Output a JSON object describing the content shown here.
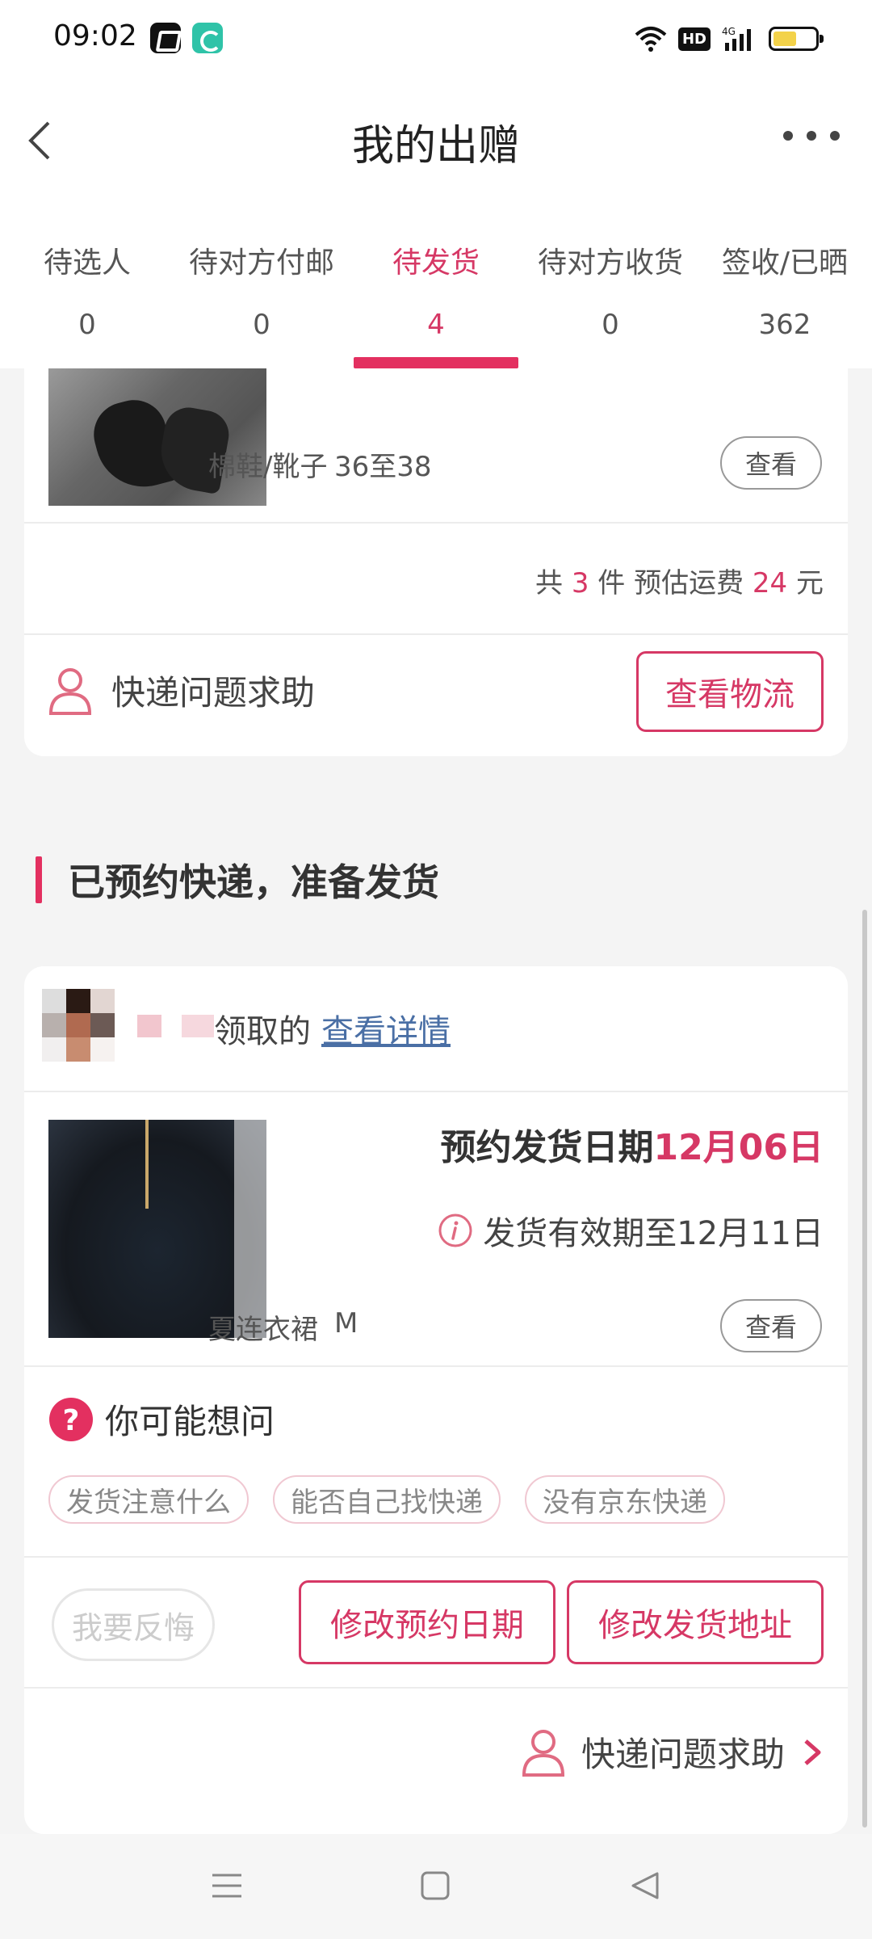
{
  "status": {
    "time": "09:02",
    "hd": "HD",
    "network": "4G"
  },
  "header": {
    "title": "我的出赠"
  },
  "tabs": [
    {
      "label": "待选人",
      "count": "0"
    },
    {
      "label": "待对方付邮",
      "count": "0"
    },
    {
      "label": "待发货",
      "count": "4",
      "active": true
    },
    {
      "label": "待对方收货",
      "count": "0"
    },
    {
      "label": "签收/已晒",
      "count": "362"
    }
  ],
  "card1": {
    "item_name": "棉鞋/靴子",
    "item_size": "36至38",
    "view_label": "查看",
    "summary_prefix": "共",
    "summary_count": "3",
    "summary_middle": "件 预估运费",
    "summary_fee": "24",
    "summary_suffix": "元",
    "help_label": "快递问题求助",
    "logistics_label": "查看物流"
  },
  "section": {
    "title": "已预约快递，准备发货"
  },
  "card2": {
    "receiver_suffix": "领取的",
    "detail_link": "查看详情",
    "ship_date_label": "预约发货日期",
    "ship_date_value": "12月06日",
    "valid_label": "发货有效期至12月11日",
    "item_name": "夏连衣裙",
    "item_size": "M",
    "view_label": "查看",
    "faq_title": "你可能想问",
    "faq_chips": [
      "发货注意什么",
      "能否自己找快递",
      "没有京东快递"
    ],
    "regret_label": "我要反悔",
    "change_date_label": "修改预约日期",
    "change_address_label": "修改发货地址",
    "help_label": "快递问题求助"
  },
  "colors": {
    "accent": "#d63865",
    "link": "#4a6fa5"
  }
}
